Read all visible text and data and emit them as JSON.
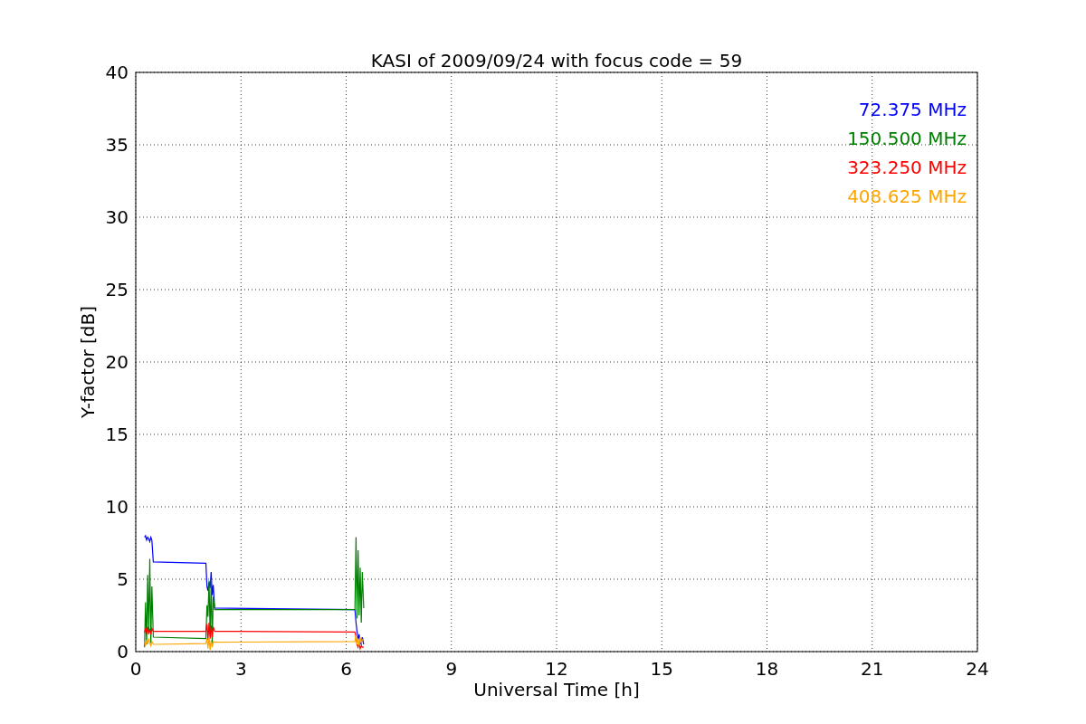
{
  "chart_data": {
    "type": "line",
    "title": "KASI of 2009/09/24 with focus code = 59",
    "xlabel": "Universal Time [h]",
    "ylabel": "Y-factor [dB]",
    "x": [
      0.25,
      0.28,
      0.31,
      0.34,
      0.37,
      0.4,
      0.43,
      0.46,
      0.5,
      2.0,
      2.03,
      2.06,
      2.09,
      2.12,
      2.15,
      2.18,
      2.21,
      2.25,
      6.25,
      6.28,
      6.31,
      6.34,
      6.37,
      6.4,
      6.43,
      6.46,
      6.5
    ],
    "series": [
      {
        "name": "72.375 MHz",
        "color": "#0000ff",
        "values": [
          7.9,
          8.0,
          7.7,
          7.9,
          7.8,
          7.6,
          7.9,
          7.7,
          6.2,
          6.1,
          4.5,
          4.2,
          4.8,
          4.4,
          5.5,
          3.9,
          4.6,
          3.0,
          2.9,
          2.0,
          1.4,
          0.8,
          1.2,
          0.6,
          0.5,
          1.0,
          0.5
        ]
      },
      {
        "name": "150.500 MHz",
        "color": "#008000",
        "values": [
          0.3,
          3.4,
          0.5,
          5.3,
          1.2,
          6.4,
          0.6,
          4.5,
          1.0,
          0.9,
          3.2,
          2.4,
          4.9,
          1.1,
          5.0,
          0.5,
          3.8,
          2.9,
          2.9,
          7.9,
          2.3,
          7.0,
          2.5,
          5.8,
          2.0,
          5.5,
          3.0
        ]
      },
      {
        "name": "323.250 MHz",
        "color": "#ff0000",
        "values": [
          1.3,
          1.6,
          1.2,
          1.7,
          1.3,
          1.5,
          1.2,
          1.6,
          1.4,
          1.4,
          1.9,
          0.8,
          2.0,
          0.9,
          1.8,
          1.0,
          1.7,
          1.4,
          1.35,
          1.0,
          0.5,
          0.3,
          0.6,
          0.2,
          0.4,
          0.3,
          0.3
        ]
      },
      {
        "name": "408.625 MHz",
        "color": "#ffa500",
        "values": [
          0.7,
          0.4,
          0.8,
          0.5,
          0.9,
          0.6,
          0.4,
          0.7,
          0.5,
          0.55,
          0.9,
          0.2,
          1.0,
          0.1,
          0.8,
          0.3,
          0.7,
          0.65,
          0.7,
          1.2,
          0.5,
          0.9,
          0.4,
          1.0,
          0.6,
          0.8,
          0.9
        ]
      }
    ],
    "grid": true,
    "xlim": [
      0,
      24
    ],
    "ylim": [
      0,
      40
    ],
    "xticks": [
      0,
      3,
      6,
      9,
      12,
      15,
      18,
      21,
      24
    ],
    "yticks": [
      0,
      5,
      10,
      15,
      20,
      25,
      30,
      35,
      40
    ]
  }
}
